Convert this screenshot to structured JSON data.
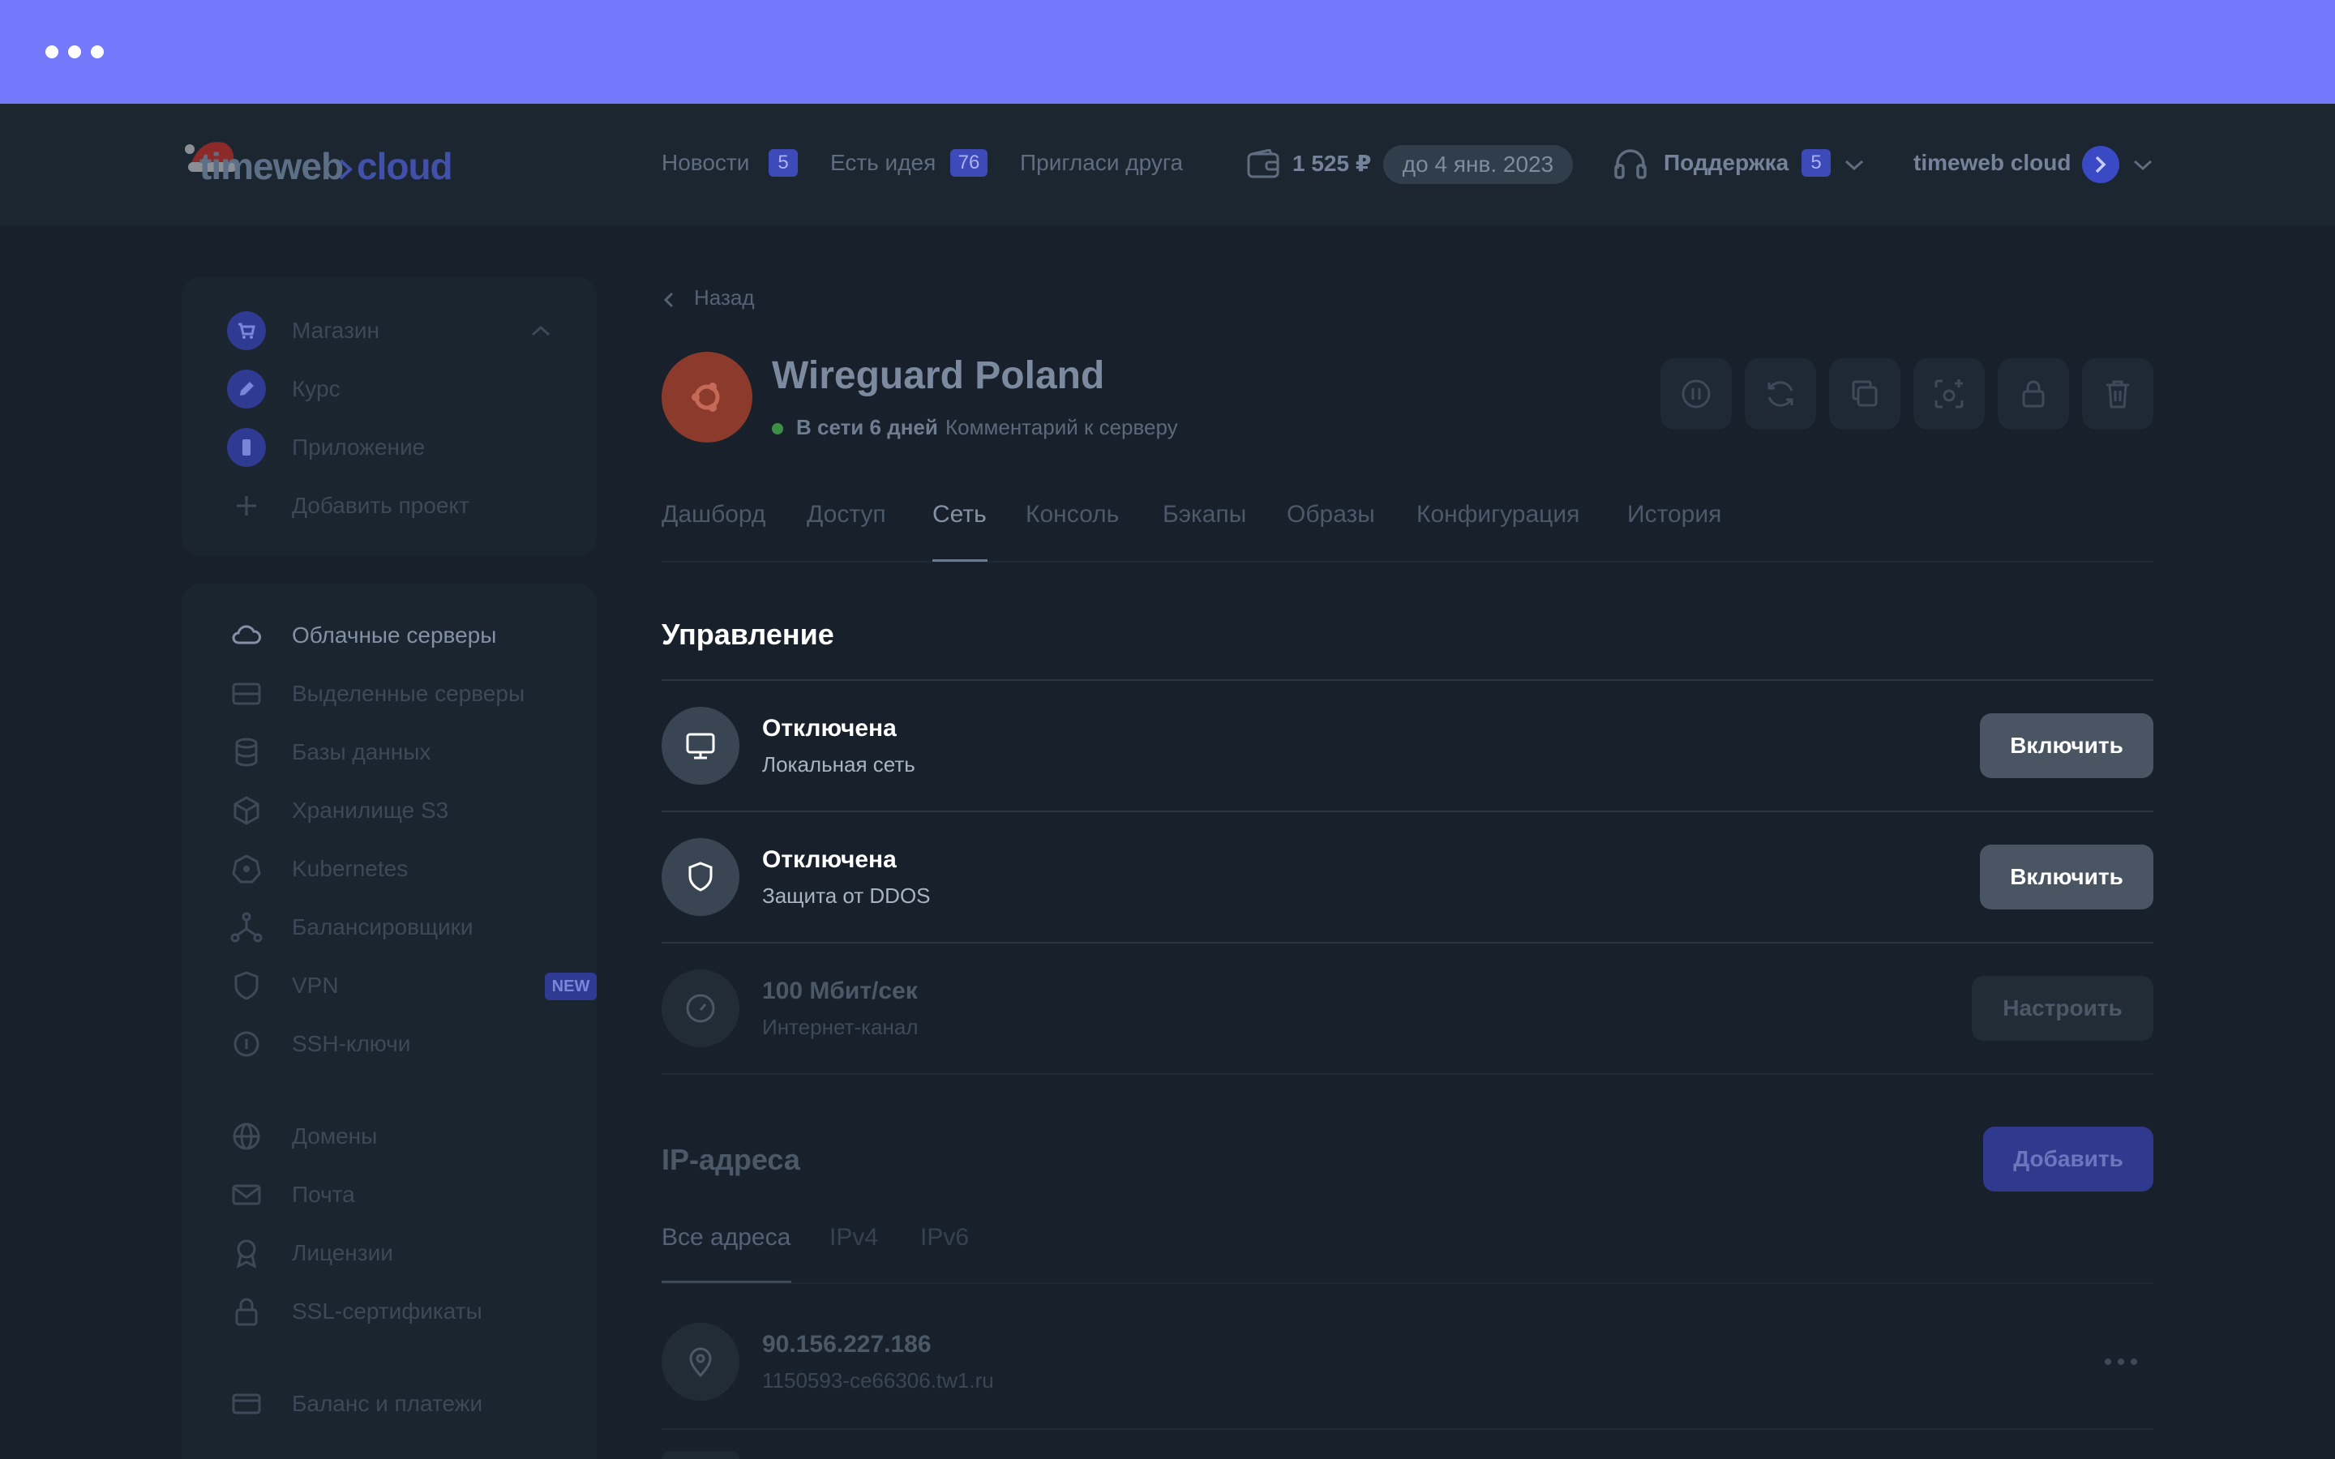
{
  "logo": {
    "text_left": "timeweb",
    "text_right": "cloud"
  },
  "topbar": {
    "news_label": "Новости",
    "news_count": "5",
    "idea_label": "Есть идея",
    "idea_count": "76",
    "invite_label": "Пригласи друга",
    "balance": "1 525 ₽",
    "paid_until": "до 4 янв. 2023",
    "support_label": "Поддержка",
    "support_count": "5",
    "account_name": "timeweb cloud"
  },
  "sidebar": {
    "projects": [
      {
        "label": "Магазин",
        "icon": "cart-icon"
      },
      {
        "label": "Курс",
        "icon": "pencil-icon"
      },
      {
        "label": "Приложение",
        "icon": "phone-icon"
      }
    ],
    "add_project_label": "Добавить проект",
    "services": [
      {
        "label": "Облачные серверы",
        "icon": "cloud-icon"
      },
      {
        "label": "Выделенные серверы",
        "icon": "server-icon"
      },
      {
        "label": "Базы данных",
        "icon": "database-icon"
      },
      {
        "label": "Хранилище S3",
        "icon": "cube-icon"
      },
      {
        "label": "Kubernetes",
        "icon": "kubernetes-icon"
      },
      {
        "label": "Балансировщики",
        "icon": "balancer-icon"
      },
      {
        "label": "VPN",
        "icon": "shield-icon",
        "badge": "NEW"
      },
      {
        "label": "SSH-ключи",
        "icon": "key-icon"
      },
      {
        "label": "Домены",
        "icon": "globe-icon"
      },
      {
        "label": "Почта",
        "icon": "mail-icon"
      },
      {
        "label": "Лицензии",
        "icon": "license-icon"
      },
      {
        "label": "SSL-сертификаты",
        "icon": "lock-icon"
      },
      {
        "label": "Баланс и платежи",
        "icon": "card-icon"
      }
    ]
  },
  "server": {
    "back_label": "Назад",
    "name": "Wireguard Poland",
    "status": "В сети 6 дней",
    "comment_link": "Комментарий к серверу",
    "tools": [
      "pause-icon",
      "refresh-icon",
      "copy-icon",
      "snapshot-icon",
      "lock-icon",
      "trash-icon"
    ]
  },
  "tabs": [
    "Дашборд",
    "Доступ",
    "Сеть",
    "Консоль",
    "Бэкапы",
    "Образы",
    "Конфигурация",
    "История"
  ],
  "active_tab": "Сеть",
  "management": {
    "title": "Управление",
    "rows": [
      {
        "title": "Отключена",
        "subtitle": "Локальная сеть",
        "button": "Включить",
        "icon": "monitor-icon"
      },
      {
        "title": "Отключена",
        "subtitle": "Защита от DDOS",
        "button": "Включить",
        "icon": "shield-icon"
      },
      {
        "title": "100 Мбит/сек",
        "subtitle": "Интернет-канал",
        "button": "Настроить",
        "icon": "speedometer-icon"
      }
    ]
  },
  "ip": {
    "title": "IP-адреса",
    "add_button": "Добавить",
    "tabs": [
      "Все адреса",
      "IPv4",
      "IPv6"
    ],
    "addresses": [
      {
        "address": "90.156.227.186",
        "hostname": "1150593-ce66306.tw1.ru",
        "icon": "location-pin-icon"
      }
    ]
  },
  "colors": {
    "chrome": "#7478fa",
    "background": "#18212b",
    "accent": "#3e4ab8",
    "status_online": "#3c8f45",
    "server_avatar": "#8c3a2c"
  }
}
